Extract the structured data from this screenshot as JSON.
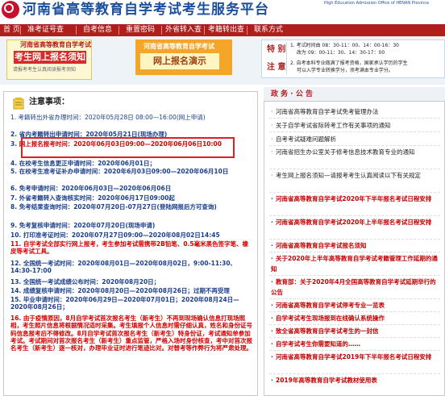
{
  "header": {
    "title": "河南省高等教育自学考试考生服务平台",
    "subtitle_en": "High Education Admission Office of HENAN Province"
  },
  "nav": {
    "items": [
      "首 页",
      "准考证号查",
      "自考信息",
      "重置密码",
      "外省转入查",
      "考籍转出查",
      "联系方式"
    ]
  },
  "banner": {
    "left_top": "河南省高等教育自学考试",
    "left_main": "考生网上报名须知",
    "left_bottom": "请报考考生认真阅读报考须知",
    "mid_top": "河南省高等教育自学考试",
    "mid_main": "网上报名演示",
    "right_label1": "特 别",
    "right_label2": "注 意",
    "right_lines": [
      "1. 考试时间由 08：30-11：00、14：00-16：30",
      "　 改为 09：00-11：30、14：30-17：00",
      "2. 自考本科专业做满了报考资格，国家承认学历的学生",
      "　 可以入学专业转换学分，须考满本专业学分。"
    ]
  },
  "notice": {
    "title": "注意事项：",
    "items": [
      {
        "num": "1.",
        "text": "考籍转出外省办理时间：2020年05月28日 08:00—16:00(网上申请)",
        "color": "blue"
      },
      {
        "num": "2.",
        "text": "省内考籍转出申请时间：2020年05月21日(现场办理)",
        "color": "blue"
      },
      {
        "num": "3.",
        "text": "网上报名报考时间：2020年06月03日09:00—2020年06月06日10:00",
        "color": "blue"
      },
      {
        "num": "4.",
        "text": "在校考生信息更正申请时间：2020年06月01日；",
        "color": "blue"
      },
      {
        "num": "5.",
        "text": "在校考生准考证补办申请时间：2020年6月03日09:00—2020年06月10日",
        "color": "blue"
      },
      {
        "num": "6.",
        "text": "免考申请时间：2020年06月03日—2020年06月06日",
        "color": "blue"
      },
      {
        "num": "7.",
        "text": "外省考籍转入查询核实时间：2020年06月17日09:00起",
        "color": "blue"
      },
      {
        "num": "8.",
        "text": "免考结果查询时间：2020年07月20日-07月27日(登陆网报后方可查询)",
        "color": "blue"
      },
      {
        "num": "9.",
        "text": "免考复核申请时间：2020年07月20日(现场申请)",
        "color": "blue"
      },
      {
        "num": "10.",
        "text": "打印准考证时间：2020年07月27日09:00—2020年08月02日14:45",
        "color": "blue"
      },
      {
        "num": "11.",
        "text": "自学考试全部实行网上报考，考生参加考试需携带2B铅笔、0.5毫米黑色签字笔、橡皮等考试工具。",
        "color": "red"
      },
      {
        "num": "12.",
        "text": "全国统一考试时间：2020年08月01日—2020年08月02日，9:00-11:30、14:30-17:00",
        "color": "blue"
      },
      {
        "num": "13.",
        "text": "全国统一考试成绩公布时间：2020年08月20日；",
        "color": "blue"
      },
      {
        "num": "14.",
        "text": "成绩复核申请时间：2020年08月20日—2020年08月26日；过期不再受理",
        "color": "blue"
      },
      {
        "num": "15.",
        "text": "毕业申请时间：2020年06月29日—2020年07月01日；2020年08月24日—2020年08月26日；",
        "color": "blue"
      },
      {
        "num": "16.",
        "text": "由于疫情原因，8月自学考试首次报名考生（新考生）不再到现场确认信息打现场照相，考生照片信息将根据情况适时采集。考生填报个人信息时需仔细认真，姓名和身份证号码信息报考后不得修改。8月自学考试首次报名考生（新考生）特身份证，考试通知单参加考试。考试期间对首次报名考生（新考生）重点监管，严格入场时身份核查，考中对首次报名考生（新考生）逐一核对，办理毕业证时进行笔迹比对。对替考等作弊行为将严肃处理。",
        "color": "red"
      }
    ]
  },
  "news": {
    "title": "政 务 · 公 告",
    "items": [
      {
        "text": "河南省高等教育自学考试免考管理办法",
        "color": "black"
      },
      {
        "text": "关于自学考试省际转考工作有关事项的通知",
        "color": "black"
      },
      {
        "text": "自考考试疑难问题解析",
        "color": "black"
      },
      {
        "text": "河南省招生办公室关于修考信息技术教育专业的通知",
        "color": "black"
      },
      {
        "text": "考生网上报名须知—请报考考生认真阅读以下有关规定",
        "color": "black"
      },
      {
        "text": "河南省高等教育自学考试2020年下半年报名考试日程安排",
        "color": "red"
      },
      {
        "text": "河南省高等教育自学考试2020年上半年报名考试日程安排",
        "color": "red"
      },
      {
        "text": "河南省高等教育自学考试报名须知",
        "color": "red"
      },
      {
        "text": "关于2020年上半年高等教育自学考试考籍管理工作延期的通知",
        "color": "red"
      },
      {
        "text": "教育部：关于2020年4月全国高等教育自学考试延期举行的公告",
        "color": "red"
      },
      {
        "text": "河南省高等教育自学考试停考专业一览表",
        "color": "red"
      },
      {
        "text": "自学考试考生现场报到在线确认系统操作",
        "color": "red"
      },
      {
        "text": "致全省高等教育自学考试考生的一封信",
        "color": "red"
      },
      {
        "text": "自学考试考生你需要知道的……",
        "color": "red"
      },
      {
        "text": "河南省高等教育自学考试2019年下半年报名考试日程安排",
        "color": "red"
      },
      {
        "text": "2019年高等教育自学考试教材使用表",
        "color": "red"
      }
    ]
  },
  "colors": {
    "brand_red": "#b01d1d",
    "link_blue": "#1a3e8c",
    "alert_red": "#d40000",
    "highlight_box": "#e02020"
  }
}
